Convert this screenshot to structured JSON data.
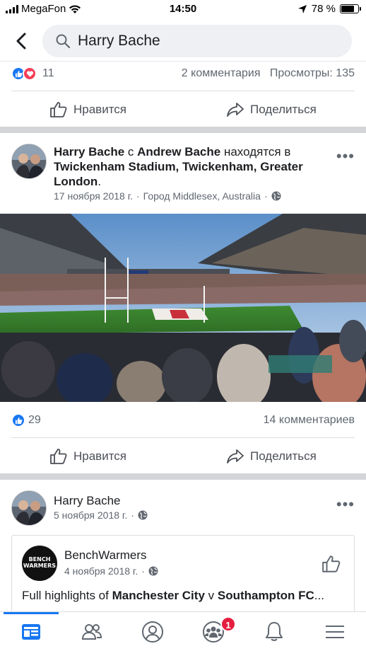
{
  "status_bar": {
    "carrier": "MegaFon",
    "time": "14:50",
    "battery": "78 %",
    "battery_level": 0.78
  },
  "search": {
    "query": "Harry Bache"
  },
  "post1": {
    "reaction_count": "11",
    "comments": "2 комментария",
    "views": "Просмотры: 135",
    "like_label": "Нравится",
    "share_label": "Поделиться"
  },
  "post2": {
    "author": "Harry Bache",
    "with_word": "с",
    "tagged": "Andrew Bache",
    "at_word": "находятся в",
    "place": "Twickenham Stadium, Twickenham, Greater London",
    "place_end": ".",
    "date": "17 ноября 2018 г.",
    "separator": "·",
    "location": "Город Middlesex, Australia",
    "reaction_count": "29",
    "comments": "14 комментариев",
    "like_label": "Нравится",
    "share_label": "Поделиться"
  },
  "post3": {
    "author": "Harry Bache",
    "date": "5 ноября 2018 г.",
    "separator": "·",
    "shared": {
      "logo_text": "BENCH WARMERS",
      "name": "BenchWarmers",
      "date": "4 ноября 2018 г.",
      "separator": "·",
      "text_prefix": "Full highlights of ",
      "team1": "Manchester City",
      "vs": " v ",
      "team2": "Southampton FC",
      "ellipsis": "..."
    }
  },
  "tabbar": {
    "groups_badge": "1"
  },
  "colors": {
    "accent": "#1877f2",
    "love": "#f33e58",
    "badge": "#e41e3f"
  }
}
